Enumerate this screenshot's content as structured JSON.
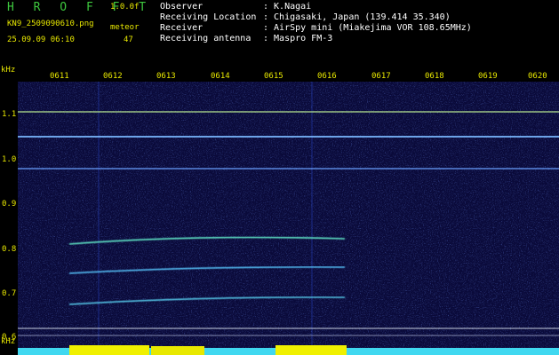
{
  "header": {
    "brand": "H R O F F T",
    "version": "1.0.0f",
    "filename": "KN9_2509090610.png",
    "mode_label": "meteor",
    "datetime": "25.09.09 06:10",
    "count": "47"
  },
  "info": [
    {
      "key": "Observer",
      "value": ": K.Nagai"
    },
    {
      "key": "Receiving Location",
      "value": ": Chigasaki, Japan (139.414 35.340)"
    },
    {
      "key": "Receiver",
      "value": ": AirSpy mini (Miakejima VOR 108.65MHz)"
    },
    {
      "key": "Receiving antenna",
      "value": ": Maspro FM-3"
    }
  ],
  "axis": {
    "unit": "kHz",
    "time_ticks": [
      "0611",
      "0612",
      "0613",
      "0614",
      "0615",
      "0616",
      "0617",
      "0618",
      "0619",
      "0620"
    ],
    "freq_ticks": [
      "1.1",
      "1.0",
      "0.9",
      "0.8",
      "0.7",
      "0.6"
    ]
  },
  "colors": {
    "accent_green": "#3ec83e",
    "label_yellow": "#e8e800",
    "background": "#000000",
    "plot_background": "#0a0a3a"
  }
}
